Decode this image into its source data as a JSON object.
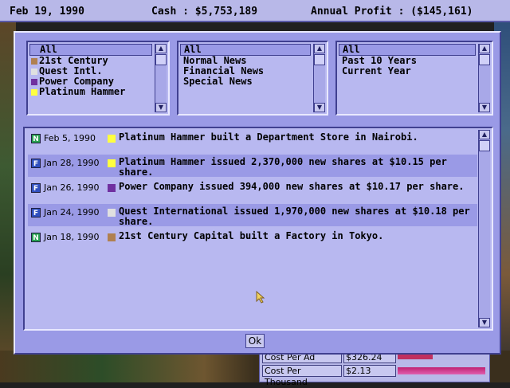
{
  "status_bar": {
    "date": "Feb 19, 1990",
    "cash": "Cash : $5,753,189",
    "annual_profit": "Annual Profit : ($145,161)"
  },
  "background_table": {
    "rows": [
      {
        "label": "Cost Per Ad",
        "value": "$326.24"
      },
      {
        "label": "Cost Per Thousand",
        "value": "$2.13"
      }
    ]
  },
  "filters": {
    "companies": {
      "items": [
        {
          "label": "All",
          "color": "",
          "selected": true
        },
        {
          "label": "21st Century",
          "color": "#b08050"
        },
        {
          "label": "Quest Intl.",
          "color": "#e0e0e0"
        },
        {
          "label": "Power Company",
          "color": "#7030a0"
        },
        {
          "label": "Platinum Hammer",
          "color": "#ffff40"
        }
      ]
    },
    "news_types": {
      "items": [
        {
          "label": "All",
          "selected": true
        },
        {
          "label": "Normal News"
        },
        {
          "label": "Financial News"
        },
        {
          "label": "Special News"
        }
      ]
    },
    "periods": {
      "items": [
        {
          "label": "All",
          "selected": true
        },
        {
          "label": "Past 10 Years"
        },
        {
          "label": "Current Year"
        }
      ]
    }
  },
  "news": [
    {
      "badge": "N",
      "date": "Feb 5, 1990",
      "color": "#ffff40",
      "text": "Platinum Hammer built a Department Store in Nairobi."
    },
    {
      "badge": "F",
      "date": "Jan 28, 1990",
      "color": "#ffff40",
      "text": "Platinum Hammer issued 2,370,000 new shares at $10.15 per share."
    },
    {
      "badge": "F",
      "date": "Jan 26, 1990",
      "color": "#7030a0",
      "text": "Power Company issued 394,000 new shares at $10.17 per share."
    },
    {
      "badge": "F",
      "date": "Jan 24, 1990",
      "color": "#e0e0e0",
      "text": "Quest International issued 1,970,000 new shares at $10.18 per share."
    },
    {
      "badge": "N",
      "date": "Jan 18, 1990",
      "color": "#b08050",
      "text": "21st Century Capital built a Factory in Tokyo."
    }
  ],
  "ok_button": {
    "label": "Ok"
  },
  "colors": {
    "dialog_bg": "#9a9ae6",
    "list_bg": "#b8b8f0",
    "news_badge": "#28a050",
    "financial_badge": "#3050c0"
  }
}
